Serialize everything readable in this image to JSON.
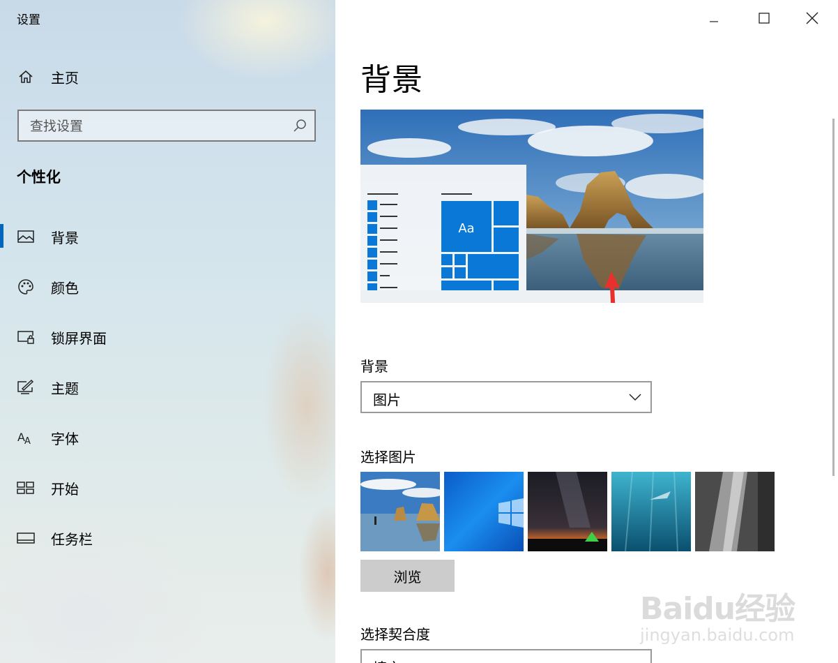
{
  "window": {
    "title": "设置"
  },
  "sidebar": {
    "home_label": "主页",
    "search_placeholder": "查找设置",
    "section_title": "个性化",
    "items": [
      {
        "label": "背景",
        "icon": "picture-icon",
        "active": true
      },
      {
        "label": "颜色",
        "icon": "palette-icon",
        "active": false
      },
      {
        "label": "锁屏界面",
        "icon": "lock-screen-icon",
        "active": false
      },
      {
        "label": "主题",
        "icon": "theme-icon",
        "active": false
      },
      {
        "label": "字体",
        "icon": "font-icon",
        "active": false
      },
      {
        "label": "开始",
        "icon": "start-icon",
        "active": false
      },
      {
        "label": "任务栏",
        "icon": "taskbar-icon",
        "active": false
      }
    ]
  },
  "main": {
    "page_title": "背景",
    "preview": {
      "tile_text": "Aa"
    },
    "background_label": "背景",
    "background_value": "图片",
    "choose_picture_label": "选择图片",
    "browse_label": "浏览",
    "fit_label": "选择契合度",
    "fit_value": "填充"
  },
  "watermark": {
    "line1": "Baidu经验",
    "line2": "jingyan.baidu.com"
  },
  "colors": {
    "accent": "#0067c0",
    "tile_blue": "#0a78d7",
    "arrow_red": "#e8312c"
  }
}
